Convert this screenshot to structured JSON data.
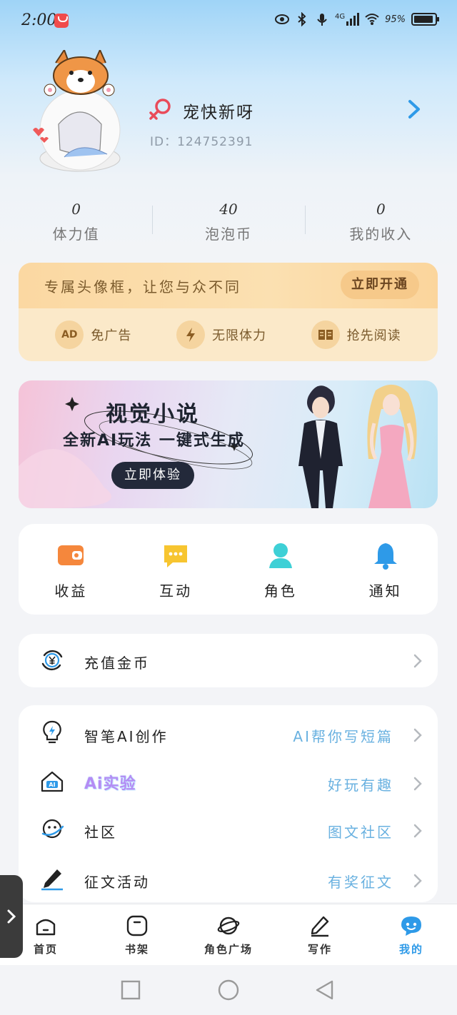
{
  "status_bar": {
    "time": "2:00",
    "network": "4G",
    "battery": "95%"
  },
  "profile": {
    "username": "宠快新呀",
    "id_text": "ID：124752391",
    "gender": "female"
  },
  "stats": [
    {
      "value": "0",
      "label": "体力值"
    },
    {
      "value": "40",
      "label": "泡泡币"
    },
    {
      "value": "0",
      "label": "我的收入"
    }
  ],
  "vip": {
    "slogan": "专属头像框，让您与众不同",
    "button": "立即开通",
    "features": [
      {
        "icon": "ad-free-icon",
        "icon_text": "AD",
        "label": "免广告"
      },
      {
        "icon": "lightning-icon",
        "label": "无限体力"
      },
      {
        "icon": "book-icon",
        "label": "抢先阅读"
      }
    ]
  },
  "banner": {
    "title": "视觉小说",
    "subtitle": "全新AI玩法 一键式生成",
    "button": "立即体验"
  },
  "quick_actions": [
    {
      "label": "收益",
      "icon": "wallet-icon",
      "color": "#f5873c"
    },
    {
      "label": "互动",
      "icon": "chat-icon",
      "color": "#f7c530"
    },
    {
      "label": "角色",
      "icon": "person-icon",
      "color": "#3ed0d6"
    },
    {
      "label": "通知",
      "icon": "bell-icon",
      "color": "#2e9ae8"
    }
  ],
  "recharge": {
    "label": "充值金币",
    "icon": "yuan-coin-icon"
  },
  "menu": [
    {
      "label": "智笔AI创作",
      "value": "AI帮你写短篇",
      "icon": "lightbulb-icon"
    },
    {
      "label": "Ai实验",
      "value": "好玩有趣",
      "icon": "ai-home-icon"
    },
    {
      "label": "社区",
      "value": "图文社区",
      "icon": "planet-icon"
    },
    {
      "label": "征文活动",
      "value": "有奖征文",
      "icon": "pen-icon"
    }
  ],
  "bottom_nav": [
    {
      "label": "首页",
      "icon": "home-icon",
      "active": false
    },
    {
      "label": "书架",
      "icon": "bookshelf-icon",
      "active": false
    },
    {
      "label": "角色广场",
      "icon": "planet-icon",
      "active": false
    },
    {
      "label": "写作",
      "icon": "write-icon",
      "active": false
    },
    {
      "label": "我的",
      "icon": "profile-chat-icon",
      "active": true
    }
  ],
  "colors": {
    "accent": "#2e9ae8",
    "vip_bg": "#fbe9c9",
    "menu_value": "#69b1e0"
  }
}
